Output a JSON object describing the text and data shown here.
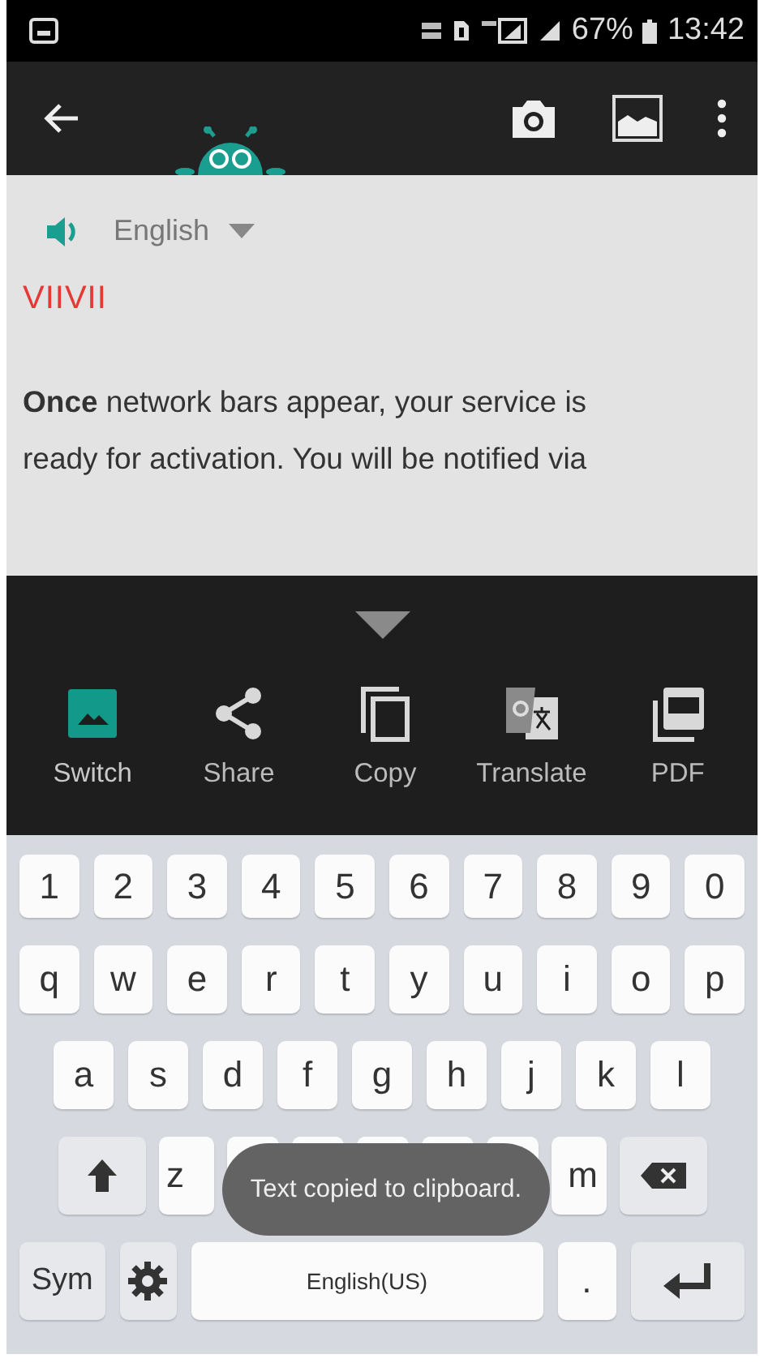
{
  "status_bar": {
    "battery": "67%",
    "time": "13:42"
  },
  "content": {
    "language": "English",
    "title": "VIIVII",
    "lines": [
      "**Once** network bars appear, your service is",
      "ready for activation. You will be notified via"
    ]
  },
  "actions": [
    {
      "kind": "switch",
      "label": "Switch",
      "selected": true
    },
    {
      "kind": "share",
      "label": "Share",
      "selected": false
    },
    {
      "kind": "copy",
      "label": "Copy",
      "selected": false
    },
    {
      "kind": "translate",
      "label": "Translate",
      "selected": false
    },
    {
      "kind": "pdf",
      "label": "PDF",
      "selected": false
    }
  ],
  "keyboard": {
    "rows": [
      {
        "keys": [
          {
            "kind": "char",
            "label": "1"
          },
          {
            "kind": "char",
            "label": "2"
          },
          {
            "kind": "char",
            "label": "3"
          },
          {
            "kind": "char",
            "label": "4"
          },
          {
            "kind": "char",
            "label": "5"
          },
          {
            "kind": "char",
            "label": "6"
          },
          {
            "kind": "char",
            "label": "7"
          },
          {
            "kind": "char",
            "label": "8"
          },
          {
            "kind": "char",
            "label": "9"
          },
          {
            "kind": "char",
            "label": "0"
          }
        ]
      },
      {
        "keys": [
          {
            "kind": "char",
            "label": "q"
          },
          {
            "kind": "char",
            "label": "w"
          },
          {
            "kind": "char",
            "label": "e"
          },
          {
            "kind": "char",
            "label": "r"
          },
          {
            "kind": "char",
            "label": "t"
          },
          {
            "kind": "char",
            "label": "y"
          },
          {
            "kind": "char",
            "label": "u"
          },
          {
            "kind": "char",
            "label": "i"
          },
          {
            "kind": "char",
            "label": "o"
          },
          {
            "kind": "char",
            "label": "p"
          }
        ]
      },
      {
        "keys": [
          {
            "kind": "char",
            "label": "a"
          },
          {
            "kind": "char",
            "label": "s"
          },
          {
            "kind": "char",
            "label": "d"
          },
          {
            "kind": "char",
            "label": "f"
          },
          {
            "kind": "char",
            "label": "g"
          },
          {
            "kind": "char",
            "label": "h"
          },
          {
            "kind": "char",
            "label": "j"
          },
          {
            "kind": "char",
            "label": "k"
          },
          {
            "kind": "char",
            "label": "l"
          }
        ]
      },
      {
        "keys": [
          {
            "kind": "shift"
          },
          {
            "kind": "char",
            "label": "z"
          },
          {
            "kind": "hidden"
          },
          {
            "kind": "hidden"
          },
          {
            "kind": "hidden"
          },
          {
            "kind": "hidden"
          },
          {
            "kind": "hidden"
          },
          {
            "kind": "char",
            "label": "m"
          },
          {
            "kind": "backspace"
          }
        ]
      },
      {
        "keys": [
          {
            "kind": "sym",
            "label": "Sym"
          },
          {
            "kind": "settings"
          },
          {
            "kind": "space",
            "label": "English(US)"
          },
          {
            "kind": "char",
            "label": "."
          },
          {
            "kind": "enter"
          }
        ]
      }
    ]
  },
  "toast": {
    "text": "Text copied to clipboard."
  }
}
